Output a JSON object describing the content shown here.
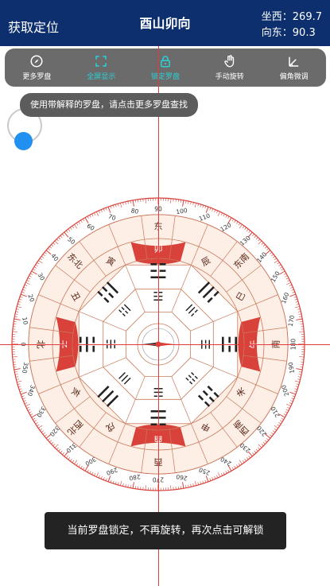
{
  "header": {
    "left_label": "获取定位",
    "title": "酉山卯向",
    "sit_label": "坐西：269.7",
    "face_label": "向东：90.3"
  },
  "toolbar": {
    "items": [
      {
        "label": "更多罗盘",
        "icon": "compass-icon"
      },
      {
        "label": "全屏显示",
        "icon": "fullscreen-icon"
      },
      {
        "label": "锁定罗盘",
        "icon": "lock-icon"
      },
      {
        "label": "手动旋转",
        "icon": "hand-icon"
      },
      {
        "label": "偏角微调",
        "icon": "angle-icon"
      }
    ]
  },
  "tooltip": {
    "text": "使用带解释的罗盘，请点击更多罗盘查找"
  },
  "toast": {
    "text": "当前罗盘锁定，不再旋转，再次点击可解锁"
  },
  "compass": {
    "degree_labels": [
      "0",
      "10",
      "20",
      "30",
      "40",
      "50",
      "60",
      "70",
      "80",
      "90",
      "100",
      "110",
      "120",
      "130",
      "140",
      "150",
      "160",
      "170",
      "180",
      "190",
      "200",
      "210",
      "220",
      "230",
      "240",
      "250",
      "260",
      "270",
      "280",
      "290",
      "300",
      "310",
      "320",
      "330",
      "340",
      "350"
    ],
    "direction_labels": [
      "北",
      "东北",
      "东",
      "东南",
      "南",
      "西南",
      "西",
      "西北"
    ],
    "mountain_labels": [
      "子",
      "丑",
      "寅",
      "卯",
      "辰",
      "巳",
      "午",
      "未",
      "申",
      "酉",
      "戌",
      "亥"
    ],
    "trigrams": [
      "☵",
      "☶",
      "☳",
      "☴",
      "☲",
      "☷",
      "☱",
      "☰"
    ],
    "colors": {
      "red": "#d8423a",
      "ring_bg": "#fdeee6",
      "line": "#c97a5a",
      "text": "#5a2a1a"
    }
  }
}
